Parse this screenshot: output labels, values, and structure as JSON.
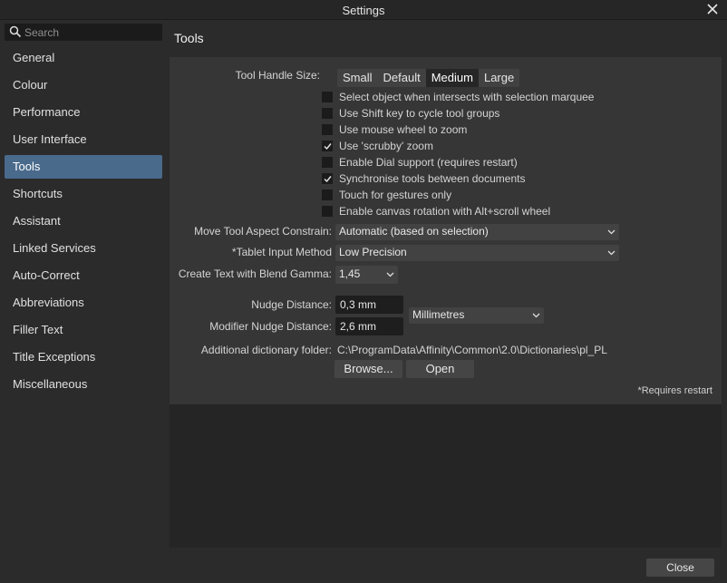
{
  "window": {
    "title": "Settings"
  },
  "search": {
    "placeholder": "Search"
  },
  "sidebar": {
    "items": [
      {
        "label": "General"
      },
      {
        "label": "Colour"
      },
      {
        "label": "Performance"
      },
      {
        "label": "User Interface"
      },
      {
        "label": "Tools",
        "selected": true
      },
      {
        "label": "Shortcuts"
      },
      {
        "label": "Assistant"
      },
      {
        "label": "Linked Services"
      },
      {
        "label": "Auto-Correct"
      },
      {
        "label": "Abbreviations"
      },
      {
        "label": "Filler Text"
      },
      {
        "label": "Title Exceptions"
      },
      {
        "label": "Miscellaneous"
      }
    ]
  },
  "page": {
    "title": "Tools"
  },
  "tool_handle": {
    "label": "Tool Handle Size:",
    "options": [
      "Small",
      "Default",
      "Medium",
      "Large"
    ],
    "selected": "Medium"
  },
  "checkboxes": [
    {
      "label": "Select object when intersects with selection marquee",
      "checked": false
    },
    {
      "label": "Use Shift key to cycle tool groups",
      "checked": false
    },
    {
      "label": "Use mouse wheel to zoom",
      "checked": false
    },
    {
      "label": "Use 'scrubby' zoom",
      "checked": true
    },
    {
      "label": "Enable Dial support (requires restart)",
      "checked": false
    },
    {
      "label": "Synchronise tools between documents",
      "checked": true
    },
    {
      "label": "Touch for gestures only",
      "checked": false
    },
    {
      "label": "Enable canvas rotation with Alt+scroll wheel",
      "checked": false
    }
  ],
  "move_tool": {
    "label": "Move Tool Aspect Constrain:",
    "value": "Automatic (based on selection)"
  },
  "tablet": {
    "label": "*Tablet Input Method",
    "value": "Low Precision"
  },
  "blend_gamma": {
    "label": "Create Text with Blend Gamma:",
    "value": "1,45"
  },
  "nudge": {
    "label": "Nudge Distance:",
    "value": "0,3 mm"
  },
  "modifier_nudge": {
    "label": "Modifier Nudge Distance:",
    "value": "2,6 mm"
  },
  "units": {
    "value": "Millimetres"
  },
  "dictionary": {
    "label": "Additional dictionary folder:",
    "path": "C:\\ProgramData\\Affinity\\Common\\2.0\\Dictionaries\\pl_PL",
    "browse_label": "Browse...",
    "open_label": "Open"
  },
  "note": "*Requires restart",
  "footer": {
    "close_label": "Close"
  },
  "colors": {
    "accent": "#4a6a8c",
    "background": "#2b2b2b",
    "group": "#363636"
  }
}
